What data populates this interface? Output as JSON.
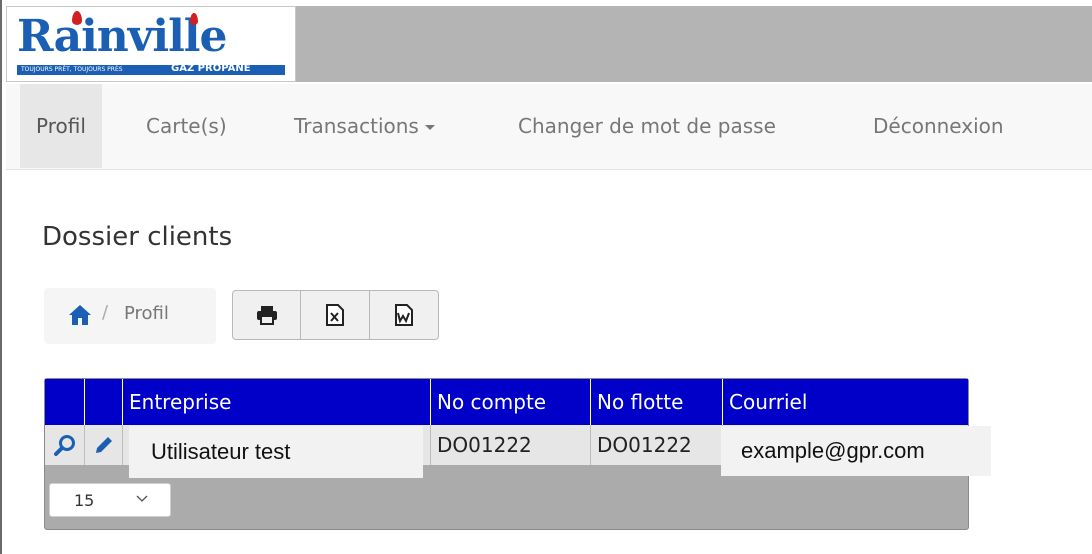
{
  "header": {
    "logo_text": "Rainville",
    "logo_tagline": "TOUJOURS PRÊT, TOUJOURS PRÈS",
    "logo_subtitle": "GAZ PROPANE",
    "brand_color": "#1a5fb4",
    "accent_color": "#d21f1f"
  },
  "nav": {
    "items": [
      {
        "label": "Profil"
      },
      {
        "label": "Carte(s)"
      },
      {
        "label": "Transactions"
      },
      {
        "label": "Changer de mot de passe"
      },
      {
        "label": "Déconnexion"
      }
    ],
    "active": "Profil"
  },
  "page": {
    "title": "Dossier clients"
  },
  "breadcrumb": {
    "home_icon": "home-icon",
    "separator": "/",
    "current": "Profil"
  },
  "export_buttons": [
    {
      "icon": "print-icon"
    },
    {
      "icon": "excel-icon"
    },
    {
      "icon": "word-icon"
    }
  ],
  "grid": {
    "header_color": "#0000c8",
    "columns": [
      "",
      "",
      "Entreprise",
      "No compte",
      "No flotte",
      "Courriel"
    ],
    "rows": [
      {
        "view_icon": "magnifier-icon",
        "edit_icon": "pencil-icon",
        "entreprise": "Utilisateur test",
        "no_compte": "DO01222",
        "no_flotte": "DO01222",
        "courriel": "example@gpr.com"
      }
    ],
    "page_size": "15"
  }
}
